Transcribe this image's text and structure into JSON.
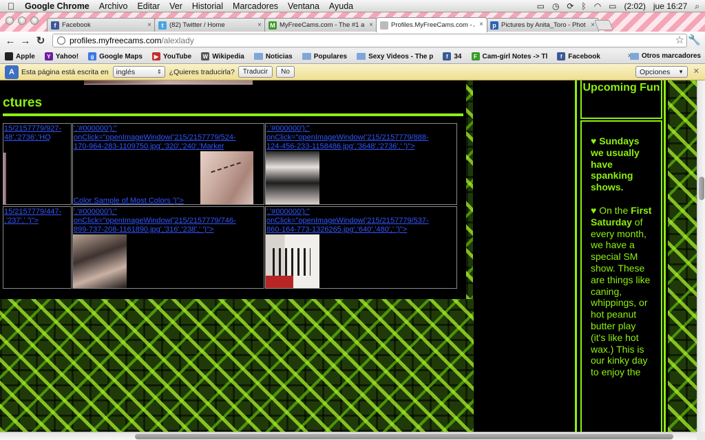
{
  "menubar": {
    "app": "Google Chrome",
    "items": [
      "Archivo",
      "Editar",
      "Ver",
      "Historial",
      "Marcadores",
      "Ventana",
      "Ayuda"
    ],
    "battery": "(2:02)",
    "clock": "jue 16:27"
  },
  "tabs": [
    {
      "label": "Facebook",
      "icon": "facebook-icon",
      "color": "#3b5998",
      "glyph": "f"
    },
    {
      "label": "(82) Twitter / Home",
      "icon": "twitter-icon",
      "color": "#4aa4e0",
      "glyph": "t"
    },
    {
      "label": "MyFreeCams.com - The #1 a",
      "icon": "myfreecams-icon",
      "color": "#3a9a2a",
      "glyph": "M"
    },
    {
      "label": "Profiles.MyFreeCams.com - A",
      "icon": "page-icon",
      "color": "#bbbbbb",
      "glyph": ""
    },
    {
      "label": "Pictures by Anita_Toro - Phot",
      "icon": "photobucket-icon",
      "color": "#2a63b5",
      "glyph": "p"
    }
  ],
  "address": {
    "host": "profiles.myfreecams.com",
    "path": "/alexlady"
  },
  "bookmarks": [
    {
      "label": "Apple",
      "icon": "apple-icon",
      "color": "#222",
      "glyph": ""
    },
    {
      "label": "Yahoo!",
      "icon": "yahoo-icon",
      "color": "#6b1fa0",
      "glyph": "Y"
    },
    {
      "label": "Google Maps",
      "icon": "google-icon",
      "color": "#3b78e7",
      "glyph": "g"
    },
    {
      "label": "YouTube",
      "icon": "youtube-icon",
      "color": "#c4302b",
      "glyph": "▶"
    },
    {
      "label": "Wikipedia",
      "icon": "wikipedia-icon",
      "color": "#555",
      "glyph": "W"
    },
    {
      "label": "Noticias",
      "icon": "folder-icon",
      "color": "",
      "glyph": ""
    },
    {
      "label": "Populares",
      "icon": "folder-icon",
      "color": "",
      "glyph": ""
    },
    {
      "label": "Sexy Videos - The p",
      "icon": "folder-icon",
      "color": "",
      "glyph": ""
    },
    {
      "label": "34",
      "icon": "facebook-icon",
      "color": "#3b5998",
      "glyph": "f"
    },
    {
      "label": "Cam-girl Notes -> Tl",
      "icon": "notes-icon",
      "color": "#3a9a2a",
      "glyph": "F"
    },
    {
      "label": "Facebook",
      "icon": "facebook-icon",
      "color": "#3b5998",
      "glyph": "f"
    }
  ],
  "bookmarks_more": "Otros marcadores",
  "translate": {
    "text1": "Esta página está escrita en",
    "language": "inglés",
    "text2": "¿Quieres traducirla?",
    "translate_btn": "Traducir",
    "no_btn": "No",
    "options": "Opciones"
  },
  "page": {
    "section_title": "ctures",
    "links": {
      "c1": "15/2157779/927-\n48','2736','HQ",
      "c2": "','#000000');\"\nonClick=\"openImageWindow('215/2157779/524-\n170-964-283-1109750.jpg','320','240','Marker",
      "c2b": "Color Sample of Most Colors ')\">",
      "c3": "','#000000');\"\nonClick=\"openImageWindow('215/2157779/888-\n124-456-233-1158486.jpg','3648','2736',' ')\">",
      "c4": "15/2157779/447-\n,'237',' ')\">",
      "c5": "','#000000');\"\nonClick=\"openImageWindow('215/2157779/746-\n899-737-208-1161890.jpg','316','238',' ')\">",
      "c6": "','#000000');\"\nonClick=\"openImageWindow('215/2157779/537-\n860-164-773-1326265.jpg','640','480',' ')\">"
    },
    "sidebar_heading": "Upcoming Fun",
    "sidebar_p1_bold": "♥ Sundays we usually have spanking shows.",
    "sidebar_p2_pre": "♥ On the ",
    "sidebar_p2_bold": "First Saturday",
    "sidebar_p2_post": " of every month, we have a special SM show. These are things like caning, whippings, or hot peanut butter play (it's like hot wax.) This is our kinky day to enjoy the"
  },
  "colors": {
    "accent": "#8ef010",
    "link": "#3355ff"
  }
}
